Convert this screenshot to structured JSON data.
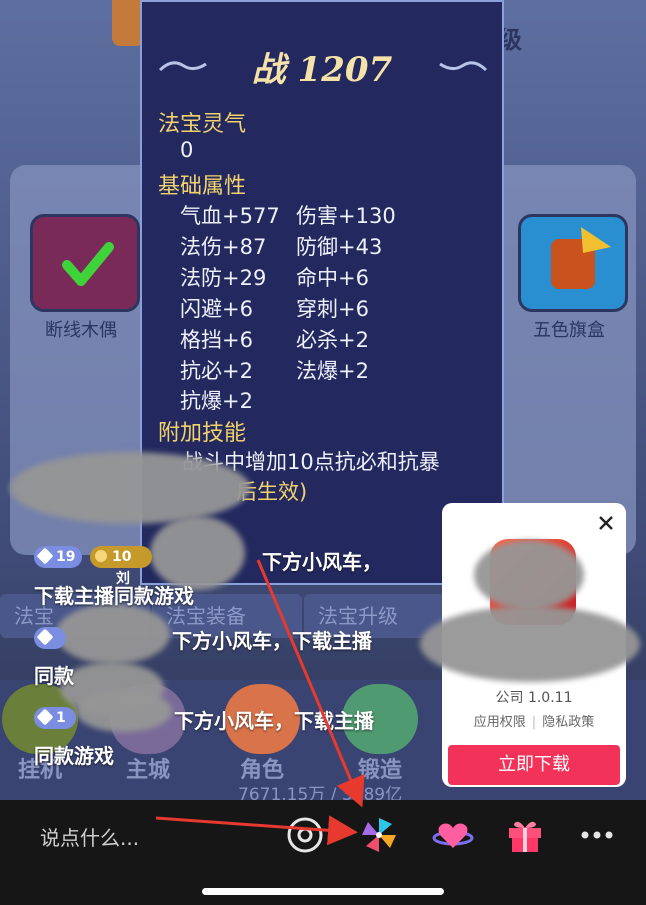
{
  "game": {
    "top_label": "级",
    "slot_left_label": "断线木偶",
    "slot_right_label": "五色旗盒",
    "tabs": [
      "法宝",
      "法宝装备",
      "法宝升级"
    ],
    "bottom_menu": [
      "挂机",
      "主城",
      "角色",
      "锻造"
    ],
    "resource_value": "7671.15万 / 3789亿"
  },
  "tooltip": {
    "power": "战 1207",
    "aura_title": "法宝灵气",
    "aura_value": "0",
    "base_title": "基础属性",
    "attributes_left": [
      "气血+577",
      "法伤+87",
      "法防+29",
      "闪避+6",
      "格挡+6",
      "抗必+2",
      "抗爆+2"
    ],
    "attributes_right": [
      "伤害+130",
      "防御+43",
      "命中+6",
      "穿刺+6",
      "必杀+2",
      "法爆+2"
    ],
    "skill_title": "附加技能",
    "skill_text": "战斗中增加10点抗必和抗暴",
    "skill_text2": "后生效)"
  },
  "chat": {
    "msg1_level": "19",
    "msg1_fan_level": "10",
    "msg1_name": "刘",
    "msg1_text": "下方小风车，",
    "msg1_text2": "下载主播同款游戏",
    "msg2_text": "下方小风车，下载主播",
    "msg2_text2": "同款",
    "msg3_level": "1",
    "msg3_text": "下方小风车，下载主播",
    "msg3_text2": "同款游戏"
  },
  "ad": {
    "close_icon": "close-icon",
    "version": "公司 1.0.11",
    "permission": "应用权限",
    "privacy": "隐私政策",
    "download": "立即下载"
  },
  "bottom_bar": {
    "placeholder": "说点什么...",
    "icons": [
      "camera-icon",
      "pinwheel-icon",
      "heart-planet-icon",
      "gift-icon",
      "more-icon"
    ]
  },
  "colors": {
    "accent_red": "#f23259",
    "arrow_red": "#e8392f",
    "tooltip_bg": "#23295f",
    "section_gold": "#f2d26b"
  }
}
